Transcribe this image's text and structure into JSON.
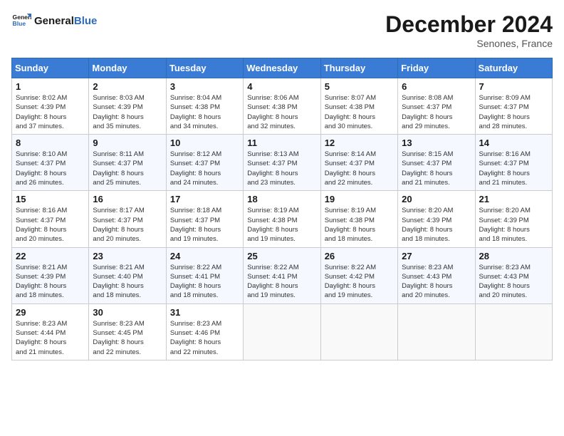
{
  "logo": {
    "text_general": "General",
    "text_blue": "Blue"
  },
  "title": "December 2024",
  "location": "Senones, France",
  "days_of_week": [
    "Sunday",
    "Monday",
    "Tuesday",
    "Wednesday",
    "Thursday",
    "Friday",
    "Saturday"
  ],
  "weeks": [
    [
      {
        "day": "1",
        "info": "Sunrise: 8:02 AM\nSunset: 4:39 PM\nDaylight: 8 hours\nand 37 minutes."
      },
      {
        "day": "2",
        "info": "Sunrise: 8:03 AM\nSunset: 4:39 PM\nDaylight: 8 hours\nand 35 minutes."
      },
      {
        "day": "3",
        "info": "Sunrise: 8:04 AM\nSunset: 4:38 PM\nDaylight: 8 hours\nand 34 minutes."
      },
      {
        "day": "4",
        "info": "Sunrise: 8:06 AM\nSunset: 4:38 PM\nDaylight: 8 hours\nand 32 minutes."
      },
      {
        "day": "5",
        "info": "Sunrise: 8:07 AM\nSunset: 4:38 PM\nDaylight: 8 hours\nand 30 minutes."
      },
      {
        "day": "6",
        "info": "Sunrise: 8:08 AM\nSunset: 4:37 PM\nDaylight: 8 hours\nand 29 minutes."
      },
      {
        "day": "7",
        "info": "Sunrise: 8:09 AM\nSunset: 4:37 PM\nDaylight: 8 hours\nand 28 minutes."
      }
    ],
    [
      {
        "day": "8",
        "info": "Sunrise: 8:10 AM\nSunset: 4:37 PM\nDaylight: 8 hours\nand 26 minutes."
      },
      {
        "day": "9",
        "info": "Sunrise: 8:11 AM\nSunset: 4:37 PM\nDaylight: 8 hours\nand 25 minutes."
      },
      {
        "day": "10",
        "info": "Sunrise: 8:12 AM\nSunset: 4:37 PM\nDaylight: 8 hours\nand 24 minutes."
      },
      {
        "day": "11",
        "info": "Sunrise: 8:13 AM\nSunset: 4:37 PM\nDaylight: 8 hours\nand 23 minutes."
      },
      {
        "day": "12",
        "info": "Sunrise: 8:14 AM\nSunset: 4:37 PM\nDaylight: 8 hours\nand 22 minutes."
      },
      {
        "day": "13",
        "info": "Sunrise: 8:15 AM\nSunset: 4:37 PM\nDaylight: 8 hours\nand 21 minutes."
      },
      {
        "day": "14",
        "info": "Sunrise: 8:16 AM\nSunset: 4:37 PM\nDaylight: 8 hours\nand 21 minutes."
      }
    ],
    [
      {
        "day": "15",
        "info": "Sunrise: 8:16 AM\nSunset: 4:37 PM\nDaylight: 8 hours\nand 20 minutes."
      },
      {
        "day": "16",
        "info": "Sunrise: 8:17 AM\nSunset: 4:37 PM\nDaylight: 8 hours\nand 20 minutes."
      },
      {
        "day": "17",
        "info": "Sunrise: 8:18 AM\nSunset: 4:37 PM\nDaylight: 8 hours\nand 19 minutes."
      },
      {
        "day": "18",
        "info": "Sunrise: 8:19 AM\nSunset: 4:38 PM\nDaylight: 8 hours\nand 19 minutes."
      },
      {
        "day": "19",
        "info": "Sunrise: 8:19 AM\nSunset: 4:38 PM\nDaylight: 8 hours\nand 18 minutes."
      },
      {
        "day": "20",
        "info": "Sunrise: 8:20 AM\nSunset: 4:39 PM\nDaylight: 8 hours\nand 18 minutes."
      },
      {
        "day": "21",
        "info": "Sunrise: 8:20 AM\nSunset: 4:39 PM\nDaylight: 8 hours\nand 18 minutes."
      }
    ],
    [
      {
        "day": "22",
        "info": "Sunrise: 8:21 AM\nSunset: 4:39 PM\nDaylight: 8 hours\nand 18 minutes."
      },
      {
        "day": "23",
        "info": "Sunrise: 8:21 AM\nSunset: 4:40 PM\nDaylight: 8 hours\nand 18 minutes."
      },
      {
        "day": "24",
        "info": "Sunrise: 8:22 AM\nSunset: 4:41 PM\nDaylight: 8 hours\nand 18 minutes."
      },
      {
        "day": "25",
        "info": "Sunrise: 8:22 AM\nSunset: 4:41 PM\nDaylight: 8 hours\nand 19 minutes."
      },
      {
        "day": "26",
        "info": "Sunrise: 8:22 AM\nSunset: 4:42 PM\nDaylight: 8 hours\nand 19 minutes."
      },
      {
        "day": "27",
        "info": "Sunrise: 8:23 AM\nSunset: 4:43 PM\nDaylight: 8 hours\nand 20 minutes."
      },
      {
        "day": "28",
        "info": "Sunrise: 8:23 AM\nSunset: 4:43 PM\nDaylight: 8 hours\nand 20 minutes."
      }
    ],
    [
      {
        "day": "29",
        "info": "Sunrise: 8:23 AM\nSunset: 4:44 PM\nDaylight: 8 hours\nand 21 minutes."
      },
      {
        "day": "30",
        "info": "Sunrise: 8:23 AM\nSunset: 4:45 PM\nDaylight: 8 hours\nand 22 minutes."
      },
      {
        "day": "31",
        "info": "Sunrise: 8:23 AM\nSunset: 4:46 PM\nDaylight: 8 hours\nand 22 minutes."
      },
      {
        "day": "",
        "info": ""
      },
      {
        "day": "",
        "info": ""
      },
      {
        "day": "",
        "info": ""
      },
      {
        "day": "",
        "info": ""
      }
    ]
  ]
}
